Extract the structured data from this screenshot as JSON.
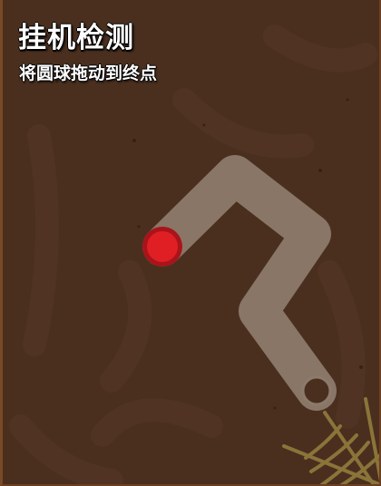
{
  "header": {
    "title": "挂机检测",
    "instruction": "将圆球拖动到终点"
  },
  "colors": {
    "background": "#4a2f1f",
    "path": "#8c7a6c",
    "ball": "#e01f24",
    "ball_ring": "#a8141a",
    "goal_fill": "#4a2f1f",
    "goal_ring": "#8c7a6c",
    "web": "#8a7439"
  },
  "icons": {
    "ball": "drag-ball",
    "goal": "target-hole",
    "corner_decoration": "spider-web-icon"
  }
}
